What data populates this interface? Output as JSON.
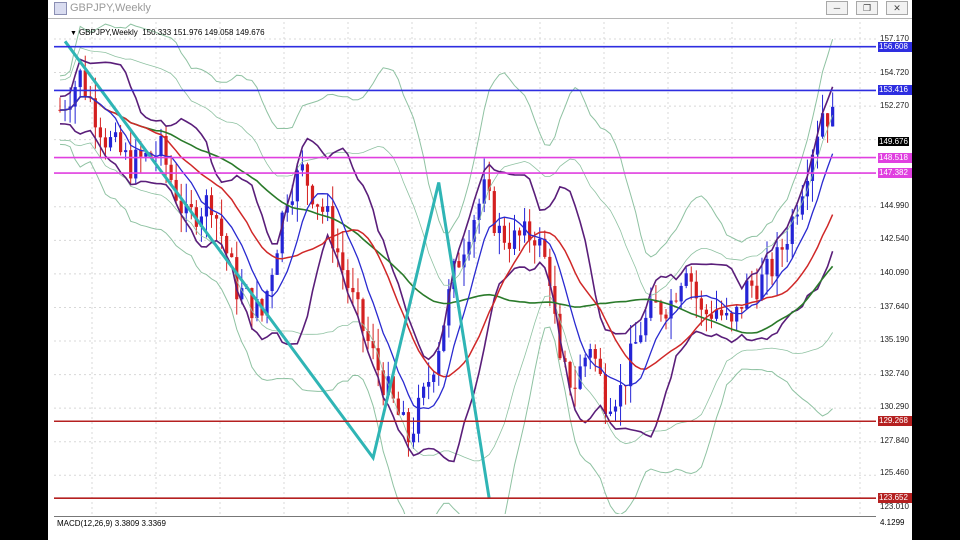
{
  "window": {
    "title": "GBPJPY,Weekly",
    "controls": [
      "minimize-icon",
      "restore-icon",
      "close-icon"
    ]
  },
  "chart": {
    "symbol_label": "GBPJPY,Weekly",
    "ohlc_label": "150.333 151.976 149.058 149.676",
    "price_ticks": [
      "157.170",
      "154.720",
      "152.270",
      "149.676",
      "144.990",
      "142.540",
      "140.090",
      "137.640",
      "135.190",
      "132.740",
      "130.290",
      "127.840",
      "125.460",
      "123.010"
    ],
    "levels": [
      {
        "label": "156.608",
        "color": "#2e2ee0"
      },
      {
        "label": "153.416",
        "color": "#2e2ee0"
      },
      {
        "label": "148.518",
        "color": "#e040e0"
      },
      {
        "label": "147.382",
        "color": "#e040e0"
      },
      {
        "label": "129.268",
        "color": "#b52020"
      },
      {
        "label": "123.652",
        "color": "#b52020"
      }
    ],
    "colors": {
      "bull_candle": "#2424d6",
      "bear_candle": "#d42020",
      "zigzag": "#2fb5b5",
      "ma_slow": "#2a7a2a",
      "ma_mid": "#d02828",
      "ma_fast": "#2a2ad0",
      "band_outer": "#5a1e7a",
      "band_wide": "#8fc2a2",
      "grid": "#d8d8d8"
    }
  },
  "macd": {
    "label": "MACD(12,26,9) 3.3809 3.3369",
    "axis_value": "4.1299"
  }
}
